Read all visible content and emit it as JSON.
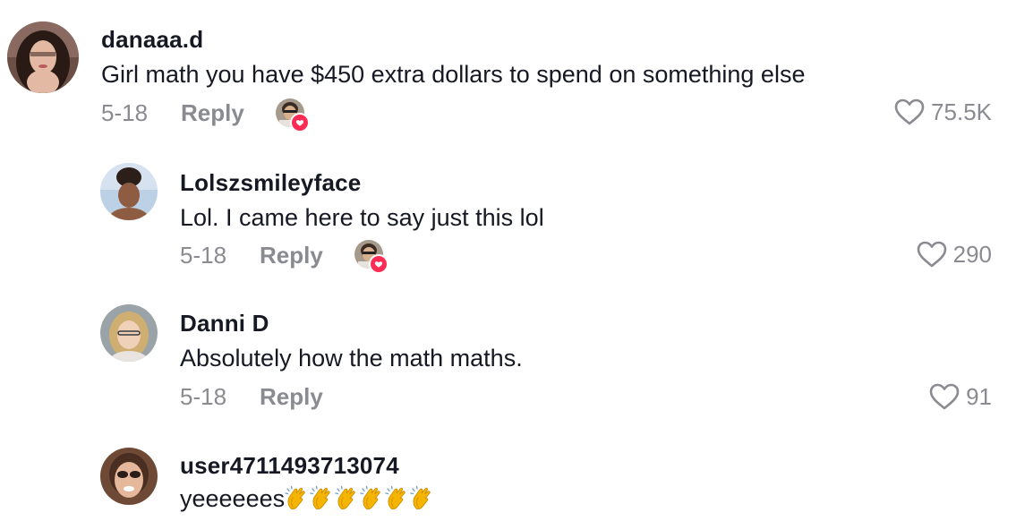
{
  "comments": [
    {
      "username": "danaaa.d",
      "text": "Girl math you have $450 extra dollars to spend on something else",
      "date": "5-18",
      "reply_label": "Reply",
      "likes": "75.5K",
      "liked_by_creator": true
    },
    {
      "username": "Lolszsmileyface",
      "text": "Lol. I came here to say just this lol",
      "date": "5-18",
      "reply_label": "Reply",
      "likes": "290",
      "liked_by_creator": true
    },
    {
      "username": "Danni D",
      "text": "Absolutely how the math maths.",
      "date": "5-18",
      "reply_label": "Reply",
      "likes": "91",
      "liked_by_creator": false
    },
    {
      "username": "user4711493713074",
      "text": "yeeeeees",
      "emoji_count": 6,
      "emoji_name": "clapping-hands"
    }
  ],
  "colors": {
    "text": "#161823",
    "muted": "#8a8b91",
    "heart_badge": "#fe2c55"
  },
  "icons": {
    "like": "heart-outline-icon",
    "creator_like": "creator-liked-badge"
  }
}
